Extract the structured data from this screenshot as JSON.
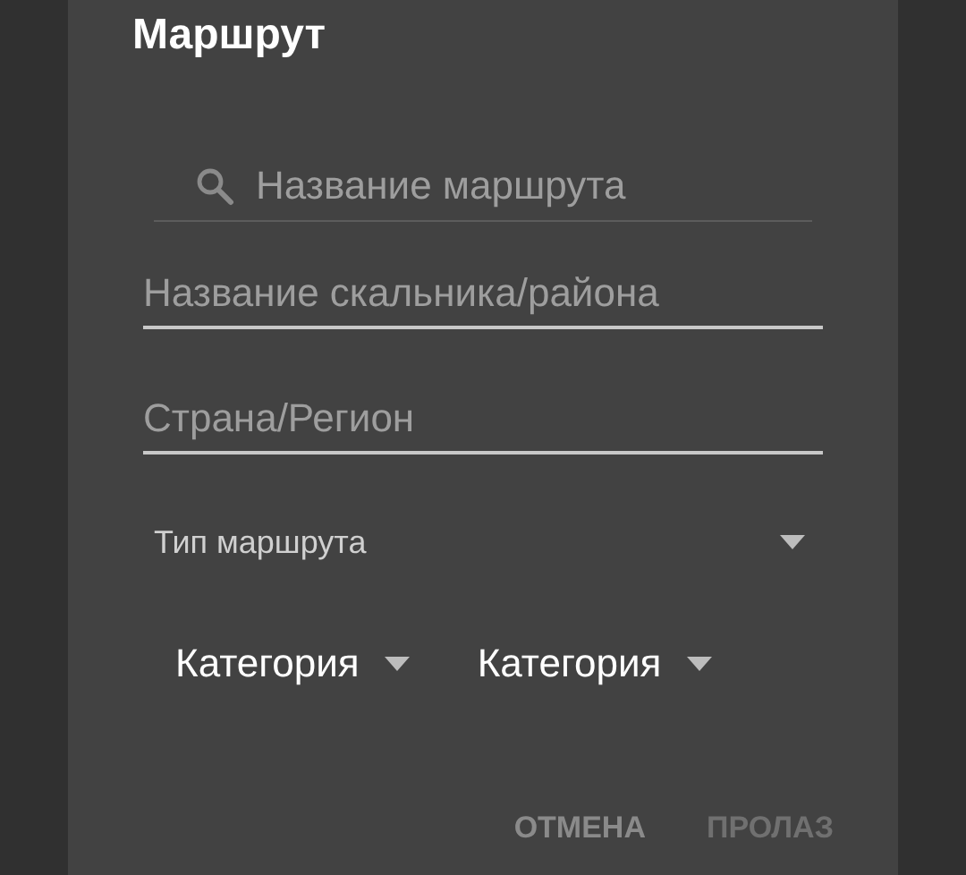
{
  "dialog": {
    "title": "Маршрут",
    "search": {
      "placeholder": "Название маршрута"
    },
    "fields": [
      {
        "placeholder": "Название скальника/района"
      },
      {
        "placeholder": "Страна/Регион"
      }
    ],
    "route_type": {
      "label": "Тип маршрута"
    },
    "categories": [
      {
        "label": "Категория"
      },
      {
        "label": "Категория"
      }
    ],
    "buttons": [
      {
        "label": "ОТМЕНА",
        "disabled": false
      },
      {
        "label": "ПРОЛАЗ",
        "disabled": true
      }
    ]
  }
}
